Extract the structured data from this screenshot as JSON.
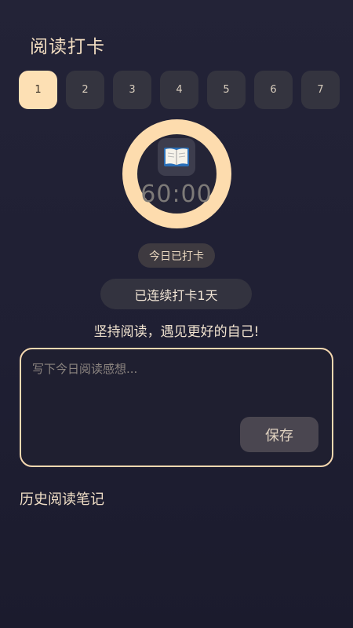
{
  "header": {
    "title": "阅读打卡"
  },
  "days": {
    "labels": [
      "1",
      "2",
      "3",
      "4",
      "5",
      "6",
      "7"
    ],
    "selected": "1"
  },
  "timer": {
    "icon": "open-book-icon",
    "time": "60:00"
  },
  "status_badge": "今日已打卡",
  "streak_text": "已连续打卡1天",
  "motto": "坚持阅读，遇见更好的自己!",
  "note": {
    "placeholder": "写下今日阅读感想...",
    "value": "",
    "save_label": "保存"
  },
  "history": {
    "title": "历史阅读笔记"
  },
  "colors": {
    "accent": "#fddcae",
    "background": "#222235",
    "chip": "#34343f",
    "selected_chip": "#fde0b4"
  }
}
